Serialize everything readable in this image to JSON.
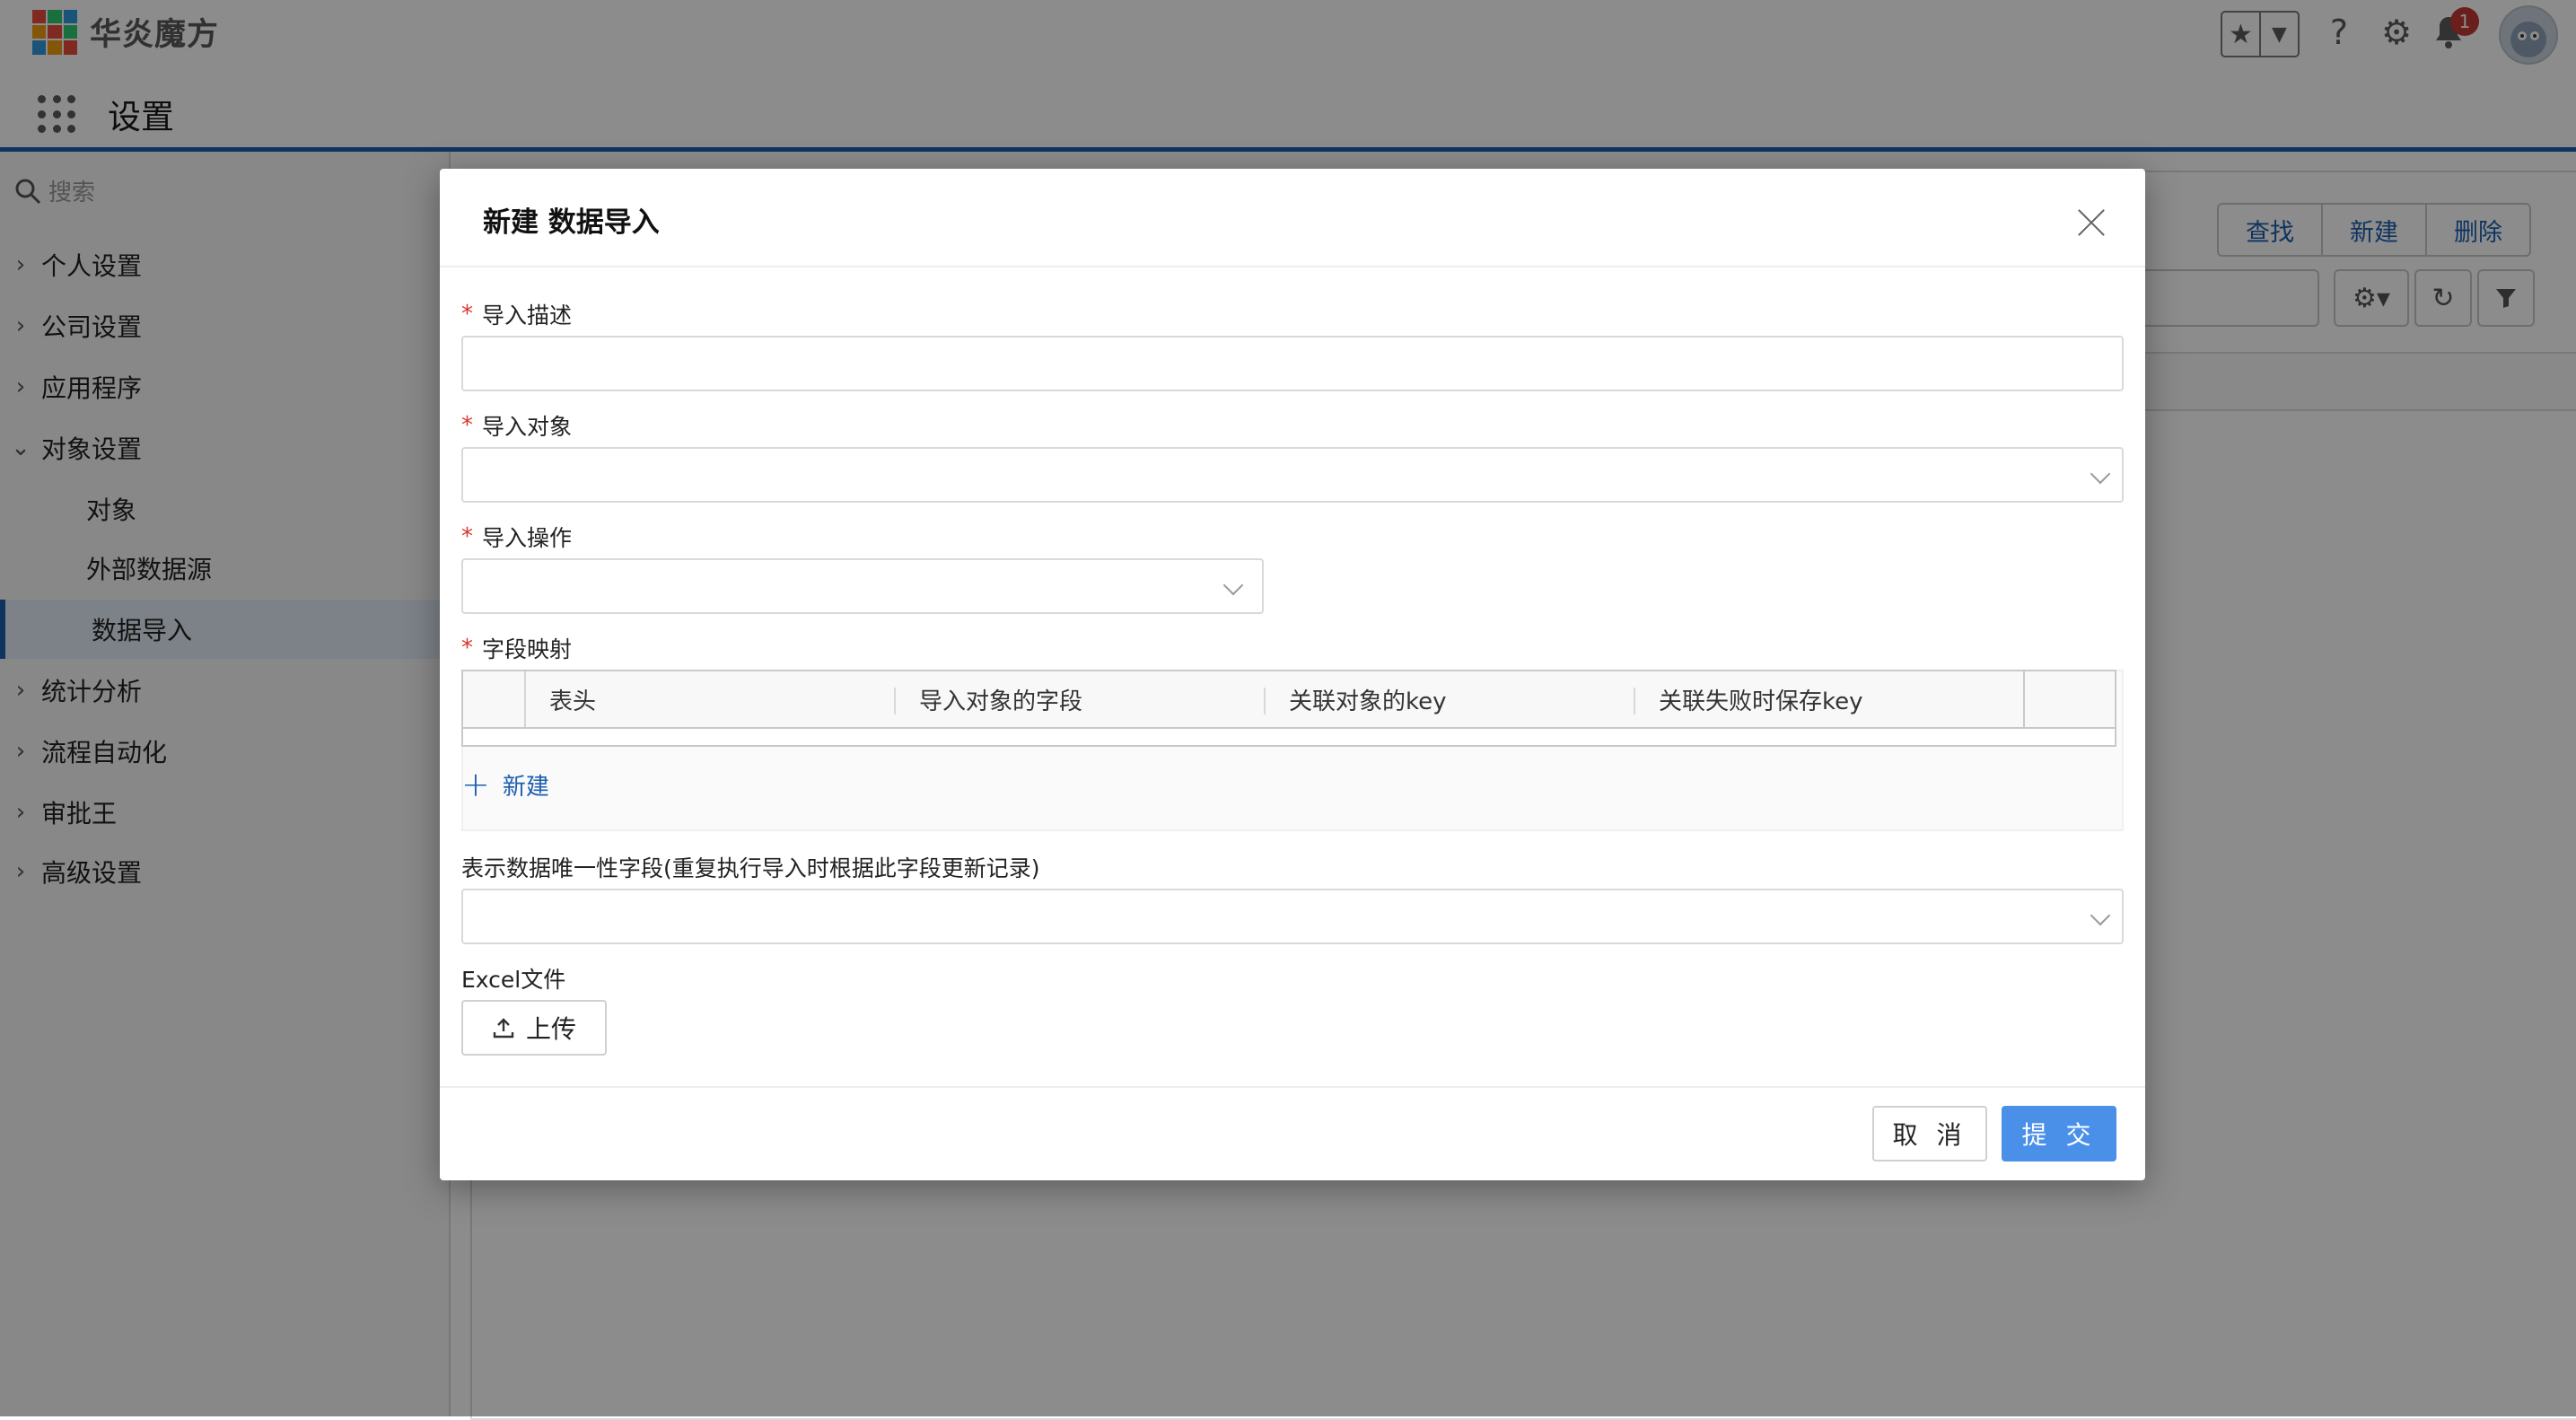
{
  "app": {
    "brand_name": "华炎魔方",
    "nav_title": "设置",
    "notification_count": "1",
    "icons": {
      "favorites": "star-icon",
      "favorites_menu": "caret-down-icon",
      "help": "question-icon",
      "settings": "gear-icon",
      "notifications": "bell-icon"
    }
  },
  "sidebar": {
    "search_placeholder": "搜索",
    "items": [
      {
        "label": "个人设置",
        "expanded": false
      },
      {
        "label": "公司设置",
        "expanded": false
      },
      {
        "label": "应用程序",
        "expanded": false
      },
      {
        "label": "对象设置",
        "expanded": true
      },
      {
        "label": "对象",
        "sub": true
      },
      {
        "label": "外部数据源",
        "sub": true
      },
      {
        "label": "数据导入",
        "sub": true,
        "active": true
      },
      {
        "label": "统计分析",
        "expanded": false
      },
      {
        "label": "流程自动化",
        "expanded": false
      },
      {
        "label": "审批王",
        "expanded": false
      },
      {
        "label": "高级设置",
        "expanded": false
      }
    ]
  },
  "main": {
    "toolbar": {
      "find_label": "查找",
      "new_label": "新建",
      "delete_label": "删除"
    }
  },
  "modal": {
    "title": "新建 数据导入",
    "fields": {
      "description": {
        "label": "导入描述",
        "required": true,
        "value": ""
      },
      "object": {
        "label": "导入对象",
        "required": true,
        "value": ""
      },
      "operation": {
        "label": "导入操作",
        "required": true,
        "value": ""
      },
      "mapping": {
        "label": "字段映射",
        "required": true,
        "columns": [
          "表头",
          "导入对象的字段",
          "关联对象的key",
          "关联失败时保存key"
        ],
        "rows": [],
        "add_label": "新建"
      },
      "unique_field": {
        "label": "表示数据唯一性字段(重复执行导入时根据此字段更新记录)",
        "value": ""
      },
      "excel": {
        "label": "Excel文件",
        "upload_label": "上传"
      }
    },
    "buttons": {
      "cancel": "取 消",
      "submit": "提 交"
    },
    "colors": {
      "primary": "#4a90e8",
      "link": "#1c5fb0",
      "required": "#d9352b"
    }
  }
}
